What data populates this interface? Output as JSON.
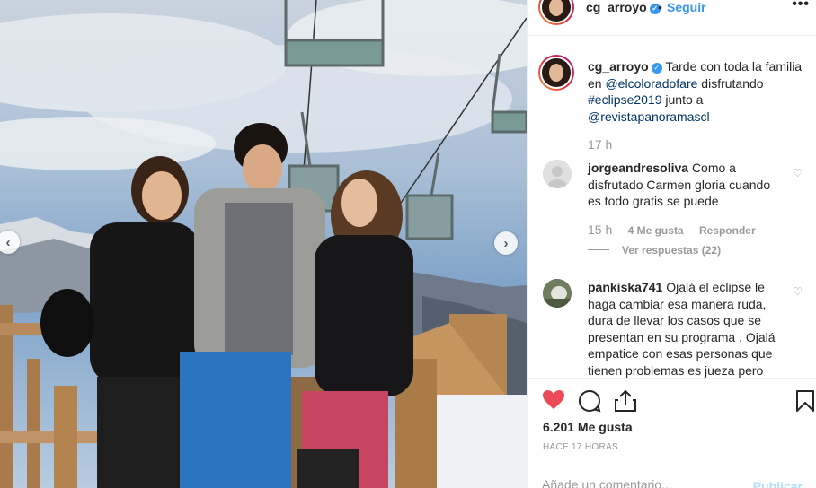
{
  "post": {
    "username": "cg_arroyo",
    "follow_label": "Seguir",
    "dot": "•",
    "more": "•••"
  },
  "caption": {
    "username": "cg_arroyo",
    "text_1": "Tarde con toda la familia en",
    "mention_1": "@elcoloradofare",
    "text_2": "disfrutando",
    "hashtag": "#eclipse2019",
    "text_3": "junto a",
    "mention_2": "@revistapanoramascl",
    "time": "17 h"
  },
  "comments": [
    {
      "username": "jorgeandresoliva",
      "text": "Como a disfrutado Carmen gloria cuando es todo gratis se puede",
      "time": "15 h",
      "likes": "4 Me gusta",
      "reply_label": "Responder",
      "replies_label": "Ver respuestas (22)"
    },
    {
      "username": "pankiska741",
      "text": "Ojalá el eclipse le haga cambiar esa manera ruda, dura de llevar los casos que se presentan en su programa . Ojalá empatice con esas personas que tienen problemas es jueza pero"
    }
  ],
  "stats": {
    "likes": "6.201 Me gusta",
    "ago": "HACE 17 HORAS"
  },
  "add_comment": {
    "placeholder": "Añade un comentario...",
    "publish_label": "Publicar"
  },
  "icons": {
    "like": "heart-icon",
    "comment": "comment-icon",
    "share": "share-icon",
    "save": "bookmark-icon",
    "verified": "verified-badge-icon",
    "prev": "chevron-left-icon",
    "next": "chevron-right-icon"
  },
  "colors": {
    "accent": "#3897f0",
    "liked": "#ed4956",
    "link": "#003569",
    "muted": "#999999"
  }
}
